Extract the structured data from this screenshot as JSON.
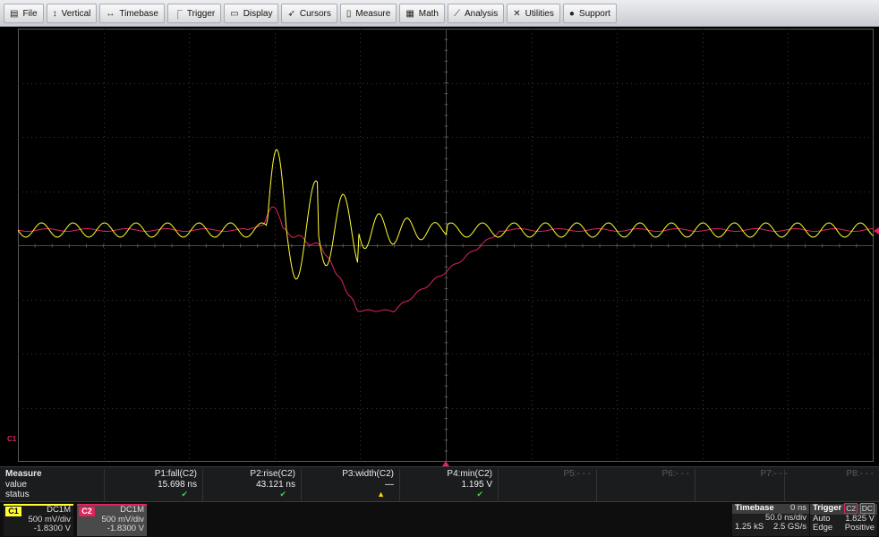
{
  "menu": {
    "items": [
      {
        "label": "File",
        "icon": "file-icon",
        "glyph": "▤"
      },
      {
        "label": "Vertical",
        "icon": "vertical-arrow-icon",
        "glyph": "↕"
      },
      {
        "label": "Timebase",
        "icon": "horizontal-arrow-icon",
        "glyph": "↔"
      },
      {
        "label": "Trigger",
        "icon": "trigger-icon",
        "glyph": "⎾"
      },
      {
        "label": "Display",
        "icon": "display-icon",
        "glyph": "▭"
      },
      {
        "label": "Cursors",
        "icon": "cursor-icon",
        "glyph": "➶"
      },
      {
        "label": "Measure",
        "icon": "measure-icon",
        "glyph": "▯"
      },
      {
        "label": "Math",
        "icon": "math-icon",
        "glyph": "▦"
      },
      {
        "label": "Analysis",
        "icon": "analysis-chart-icon",
        "glyph": "⟋"
      },
      {
        "label": "Utilities",
        "icon": "tools-icon",
        "glyph": "✕"
      },
      {
        "label": "Support",
        "icon": "info-icon",
        "glyph": "●"
      }
    ]
  },
  "graticule": {
    "trace_colors": {
      "c1": "#ffff33",
      "c2": "#e0245e"
    },
    "trace_labels": {
      "c1": "C1",
      "c2": "C2"
    },
    "marker_color": "#e0245e"
  },
  "measure": {
    "title": "Measure",
    "row_value": "value",
    "row_status": "status",
    "params": [
      {
        "label": "P1:fall(C2)",
        "value": "15.698 ns",
        "status": "✔",
        "status_type": "ok"
      },
      {
        "label": "P2:rise(C2)",
        "value": "43.121 ns",
        "status": "✔",
        "status_type": "ok"
      },
      {
        "label": "P3:width(C2)",
        "value": "—",
        "status": "▲",
        "status_type": "warn"
      },
      {
        "label": "P4:min(C2)",
        "value": "1.195 V",
        "status": "✔",
        "status_type": "ok"
      },
      {
        "label": "P5:- - -",
        "value": "",
        "status": "",
        "status_type": "none"
      },
      {
        "label": "P6:- - -",
        "value": "",
        "status": "",
        "status_type": "none"
      },
      {
        "label": "P7:- - -",
        "value": "",
        "status": "",
        "status_type": "none"
      },
      {
        "label": "P8:- - -",
        "value": "",
        "status": "",
        "status_type": "none"
      }
    ]
  },
  "channels": {
    "c1": {
      "tag": "C1",
      "coupling": "DC1M",
      "scale": "500 mV/div",
      "offset": "-1.8300 V",
      "color": "#ffff33"
    },
    "c2": {
      "tag": "C2",
      "coupling": "DC1M",
      "scale": "500 mV/div",
      "offset": "-1.8300 V",
      "color": "#e0245e"
    }
  },
  "timebase": {
    "title": "Timebase",
    "delay": "0 ns",
    "scale": "50.0 ns/div",
    "samples": "1.25 kS",
    "rate": "2.5 GS/s"
  },
  "trigger": {
    "title": "Trigger",
    "source": "C2",
    "coupling": "DC",
    "mode": "Auto",
    "level": "1.825 V",
    "type": "Edge",
    "slope": "Positive"
  }
}
